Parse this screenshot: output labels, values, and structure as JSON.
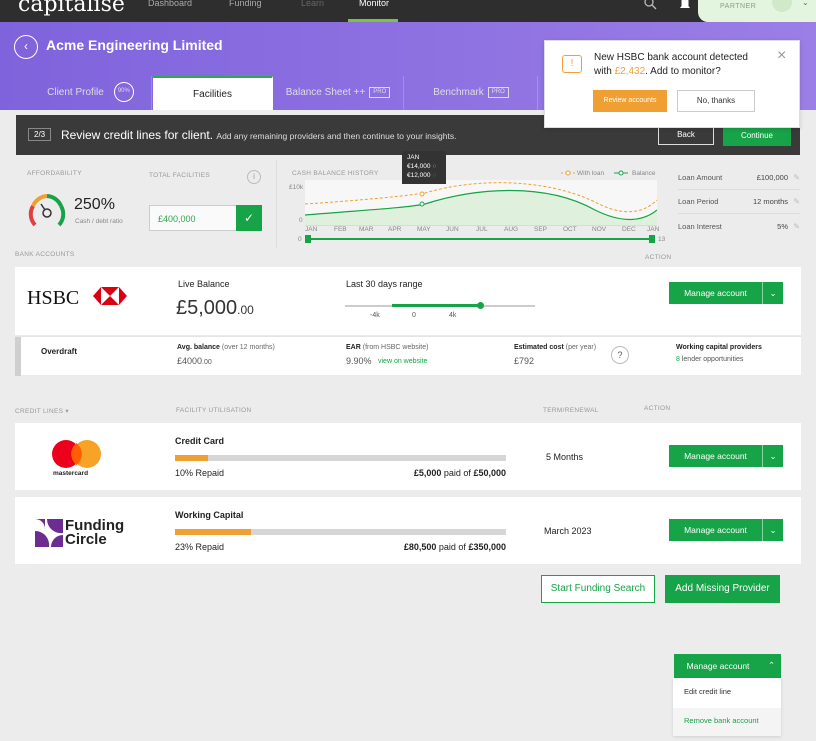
{
  "topbar": {
    "logo": "capitalise",
    "nav": [
      "Dashboard",
      "Funding",
      "Learn",
      "Monitor"
    ],
    "partner": "PARTNER"
  },
  "header": {
    "company": "Acme Engineering Limited",
    "tabs": [
      {
        "label": "Client Profile",
        "badge": "90%"
      },
      {
        "label": "Facilities"
      },
      {
        "label": "Balance Sheet ++",
        "badge": "PRO"
      },
      {
        "label": "Benchmark",
        "badge": "PRO"
      }
    ]
  },
  "banner": {
    "step": "2/3",
    "title": "Review credit lines for client.",
    "subtitle": "Add any remaining providers and then continue to your insights.",
    "back": "Back",
    "continue": "Continue"
  },
  "popup": {
    "line1": "New HSBC bank account detected",
    "line2_pre": "with ",
    "amount": "£2,432",
    "line2_post": ". Add to monitor?",
    "review": "Review accounts",
    "no": "No, thanks"
  },
  "affordability": {
    "label": "AFFORDABILITY",
    "value": "250%",
    "sub": "Cash / debt ratio",
    "level": 0.6
  },
  "facilities": {
    "label": "TOTAL FACILITIES",
    "value": "£400,000",
    "info": "i"
  },
  "cash": {
    "label": "CASH BALANCE HISTORY",
    "legend_loan": "With loan",
    "legend_balance": "Balance",
    "y_top": "£10k",
    "y_bottom": "0",
    "months": [
      "JAN",
      "FEB",
      "MAR",
      "APR",
      "MAY",
      "JUN",
      "JUL",
      "AUG",
      "SEP",
      "OCT",
      "NOV",
      "DEC",
      "JAN"
    ],
    "tooltip": {
      "month": "JAN",
      "loan": "€14,000",
      "balance": "€12,000"
    },
    "range_end": "13"
  },
  "loan": {
    "rows": [
      {
        "label": "Loan Amount",
        "value": "£100,000"
      },
      {
        "label": "Loan Period",
        "value": "12 months"
      },
      {
        "label": "Loan Interest",
        "value": "5%"
      }
    ]
  },
  "bank": {
    "section": "BANK ACCOUNTS",
    "action": "ACTION",
    "name": "HSBC",
    "live_label": "Live Balance",
    "balance": "£5,000",
    "balance_dec": ".00",
    "range_label": "Last 30 days range",
    "ticks": [
      "-4k",
      "0",
      "4k"
    ],
    "manage": "Manage account",
    "overdraft": "Overdraft",
    "avg_label": "Avg. balance",
    "avg_note": "(over 12 months)",
    "avg_value": "£4000",
    "avg_dec": ".00",
    "ear_label": "EAR",
    "ear_note": "(from HSBC website)",
    "ear_value": "9.90%",
    "ear_link": "view on website",
    "cost_label": "Estimated cost",
    "cost_note": "(per year)",
    "cost_value": "£792",
    "help": "?",
    "wcp_label": "Working capital providers",
    "wcp_count": "8",
    "wcp_text": "lender opportunities"
  },
  "credit": {
    "col_lines": "CREDIT LINES",
    "col_util": "FACILITY UTILISATION",
    "col_term": "TERM/RENEWAL",
    "col_action": "ACTION",
    "rows": [
      {
        "logo": "mastercard",
        "name": "Credit Card",
        "repaid": "10% Repaid",
        "paid": "£5,000",
        "of": "paid of",
        "total": "£50,000",
        "term": "5 Months",
        "fill": 0.1,
        "manage": "Manage account"
      },
      {
        "logo": "Funding Circle",
        "logo1": "Funding",
        "logo2": "Circle",
        "name": "Working Capital",
        "repaid": "23% Repaid",
        "paid": "£80,500",
        "of": "paid of",
        "total": "£350,000",
        "term": "March 2023",
        "fill": 0.23,
        "manage": "Manage account"
      }
    ]
  },
  "actions": {
    "start": "Start Funding Search",
    "add": "Add Missing Provider"
  },
  "dropdown": {
    "button": "Manage account",
    "items": [
      "Edit credit line",
      "Remove bank account"
    ]
  },
  "colors": {
    "green": "#17a347",
    "purple": "#8a6de2",
    "orange": "#f0a033"
  }
}
